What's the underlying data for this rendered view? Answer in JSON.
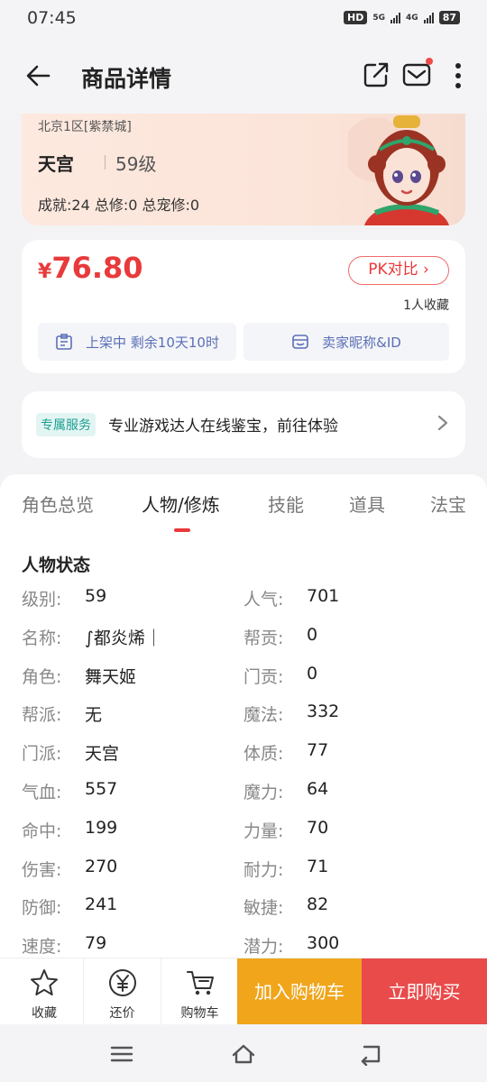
{
  "status": {
    "time": "07:45",
    "hd": "HD",
    "net1": "5G",
    "net2": "4G",
    "battery": "87"
  },
  "header": {
    "title": "商品详情"
  },
  "hero": {
    "server": "北京1区[紫禁城]",
    "sect": "天宫",
    "level": "59级",
    "stats": "成就:24 总修:0 总宠修:0"
  },
  "price_card": {
    "currency": "¥",
    "price": "76.80",
    "pk_label": "PK对比",
    "favorites": "1人收藏",
    "listing_status": "上架中 剩余10天10时",
    "seller": "卖家昵称&ID"
  },
  "service": {
    "tag": "专属服务",
    "text": "专业游戏达人在线鉴宝，前往体验"
  },
  "tabs": [
    {
      "label": "角色总览"
    },
    {
      "label": "人物/修炼"
    },
    {
      "label": "技能"
    },
    {
      "label": "道具"
    },
    {
      "label": "法宝"
    }
  ],
  "active_tab": 1,
  "character": {
    "section_title": "人物状态",
    "rows": [
      {
        "k1": "级别:",
        "v1": "59",
        "k2": "人气:",
        "v2": "701"
      },
      {
        "k1": "名称:",
        "v1": "∫都炎烯｜",
        "k2": "帮贡:",
        "v2": "0"
      },
      {
        "k1": "角色:",
        "v1": "舞天姬",
        "k2": "门贡:",
        "v2": "0"
      },
      {
        "k1": "帮派:",
        "v1": "无",
        "k2": "魔法:",
        "v2": "332"
      },
      {
        "k1": "门派:",
        "v1": "天宫",
        "k2": "体质:",
        "v2": "77"
      },
      {
        "k1": "气血:",
        "v1": "557",
        "k2": "魔力:",
        "v2": "64"
      },
      {
        "k1": "命中:",
        "v1": "199",
        "k2": "力量:",
        "v2": "70"
      },
      {
        "k1": "伤害:",
        "v1": "270",
        "k2": "耐力:",
        "v2": "71"
      },
      {
        "k1": "防御:",
        "v1": "241",
        "k2": "敏捷:",
        "v2": "82"
      },
      {
        "k1": "速度:",
        "v1": "79",
        "k2": "潜力:",
        "v2": "300"
      }
    ]
  },
  "actions": {
    "favorite": "收藏",
    "bargain": "还价",
    "cart": "购物车",
    "add_to_cart": "加入购物车",
    "buy_now": "立即购买"
  },
  "colors": {
    "price_red": "#e9393a",
    "cart_orange": "#f0a51b",
    "buy_red": "#e94b4b",
    "service_teal": "#1f9f93",
    "chip_blue": "#5a6fb7"
  }
}
